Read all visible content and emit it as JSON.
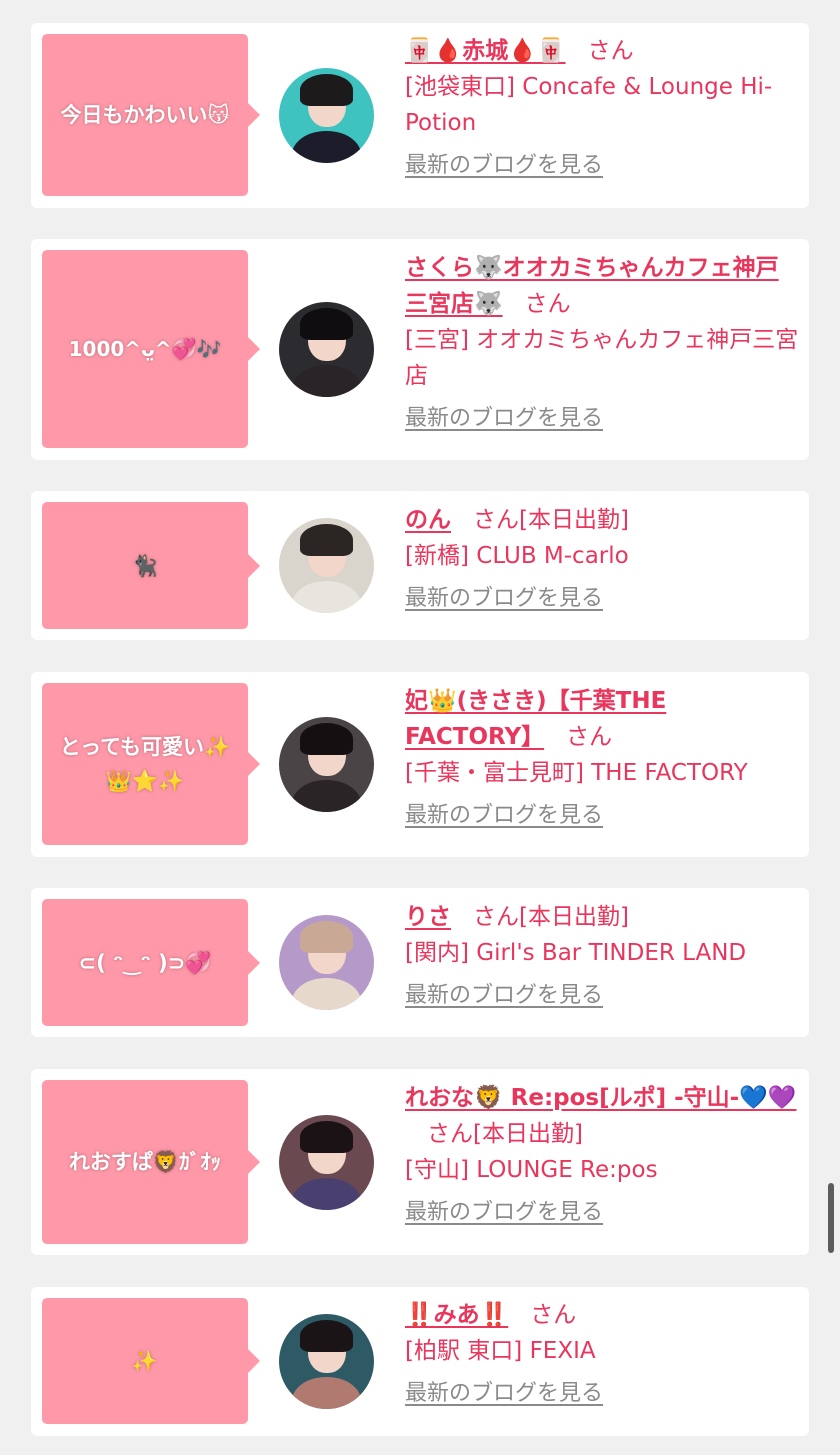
{
  "cards": [
    {
      "bubble": "今日もかわいい😽",
      "name": "🀄🩸赤城🩸🀄",
      "san": "さん",
      "status": "",
      "shop": "[池袋東口] Concafe & Lounge Hi-Potion",
      "blog_link": "最新のブログを見る",
      "avatar_bg": "#3fc3c0",
      "avatar_hair": "#1d1a1c",
      "avatar_body": "#1c1c2a"
    },
    {
      "bubble": "1000^ᴗ̤^💞🎶",
      "name": "さくら🐺オオカミちゃんカフェ神戸三宮店🐺",
      "san": "さん",
      "status": "",
      "shop": "[三宮] オオカミちゃんカフェ神戸三宮店",
      "blog_link": "最新のブログを見る",
      "avatar_bg": "#2c2c30",
      "avatar_hair": "#0f0d10",
      "avatar_body": "#2a2428"
    },
    {
      "bubble": "🐈‍⬛",
      "name": "のん",
      "san": "さん",
      "status": "[本日出勤]",
      "shop": "[新橋] CLUB M-carlo",
      "blog_link": "最新のブログを見る",
      "avatar_bg": "#d9d4cc",
      "avatar_hair": "#2b2523",
      "avatar_body": "#e8e4de"
    },
    {
      "bubble": "とっても可愛い✨\n👑⭐️✨",
      "name": "妃👑(きさき)【千葉THE FACTORY】",
      "san": "さん",
      "status": "",
      "shop": "[千葉・富士見町] THE FACTORY",
      "blog_link": "最新のブログを見る",
      "avatar_bg": "#4a4446",
      "avatar_hair": "#141012",
      "avatar_body": "#2a2426"
    },
    {
      "bubble": "⊂( ᵔ‿ᵔ )⊃💞",
      "name": "りさ",
      "san": "さん",
      "status": "[本日出勤]",
      "shop": "[関内] Girl's Bar TINDER LAND",
      "blog_link": "最新のブログを見る",
      "avatar_bg": "#b59ac9",
      "avatar_hair": "#c9a996",
      "avatar_body": "#e6d9cc"
    },
    {
      "bubble": "れおすぱ🦁ｶﾞｵｯ",
      "name": "れおな🦁 Re:pos[ルポ] -守山-💙💜",
      "san": "さん",
      "status": "[本日出勤]",
      "shop": "[守山] LOUNGE Re:pos",
      "blog_link": "最新のブログを見る",
      "avatar_bg": "#6a4a50",
      "avatar_hair": "#1a1214",
      "avatar_body": "#4a4070"
    },
    {
      "bubble": "✨",
      "name": "‼️みあ‼️",
      "san": "さん",
      "status": "",
      "shop": "[柏駅 東口] FEXIA",
      "blog_link": "最新のブログを見る",
      "avatar_bg": "#2e5a66",
      "avatar_hair": "#1a1416",
      "avatar_body": "#b07a70"
    }
  ]
}
